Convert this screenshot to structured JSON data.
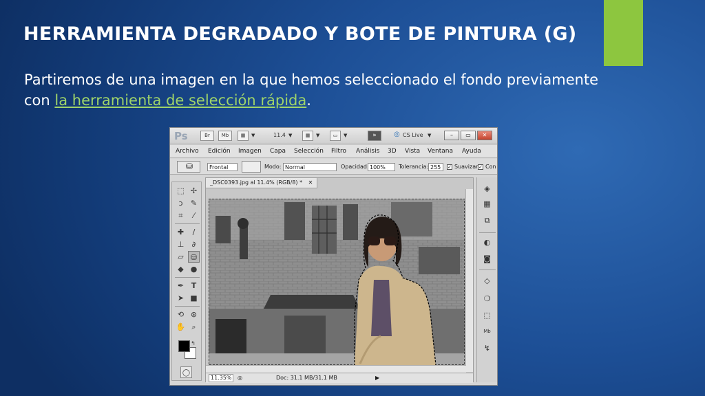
{
  "slide": {
    "title": "HERRAMIENTA DEGRADADO Y BOTE DE PINTURA (G)",
    "body_text": "Partiremos de una imagen en la que hemos seleccionado el fondo previamente con ",
    "body_link": "la herramienta de selección rápida",
    "body_end": ".",
    "accent_color": "#8dc63f",
    "link_color": "#9fd469"
  },
  "photoshop": {
    "logo": "Ps",
    "appbar": {
      "br": "Br",
      "mb": "Mb",
      "zoom": "11.4",
      "cs_live": "CS Live"
    },
    "menu": [
      "Archivo",
      "Edición",
      "Imagen",
      "Capa",
      "Selección",
      "Filtro",
      "Análisis",
      "3D",
      "Vista",
      "Ventana",
      "Ayuda"
    ],
    "options": {
      "fill_source": "Frontal",
      "mode_label": "Modo:",
      "mode_value": "Normal",
      "opacity_label": "Opacidad:",
      "opacity_value": "100%",
      "tolerance_label": "Tolerancia:",
      "tolerance_value": "255",
      "antialias_label": "Suavizar",
      "contiguous_label": "Con"
    },
    "document": {
      "tab_title": "_DSC0393.jpg al 11.4% (RGB/8) *",
      "zoom_status": "11.35%",
      "doc_size": "Doc: 31.1 MB/31.1 MB"
    },
    "tool_icons": [
      "marquee-icon",
      "move-icon",
      "lasso-icon",
      "quick-selection-icon",
      "crop-icon",
      "eyedropper-icon",
      "spot-healing-icon",
      "brush-icon",
      "clone-stamp-icon",
      "history-brush-icon",
      "eraser-icon",
      "paint-bucket-icon",
      "blur-icon",
      "dodge-icon",
      "pen-icon",
      "type-icon",
      "path-selection-icon",
      "rectangle-icon",
      "3d-rotate-icon",
      "3d-orbit-icon",
      "hand-icon",
      "zoom-icon"
    ],
    "panel_icons": [
      "mini-bridge-icon",
      "histogram-icon",
      "navigator-icon",
      "adjustments-icon",
      "masks-icon",
      "layers-icon",
      "channels-icon",
      "paths-icon",
      "3d-icon",
      "actions-icon"
    ]
  }
}
